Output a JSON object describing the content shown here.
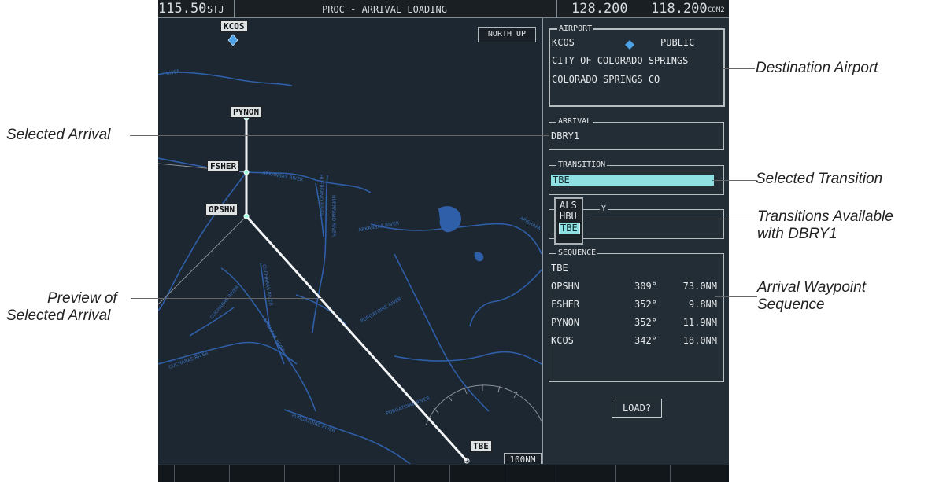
{
  "top_bar": {
    "nav_frequency": "115.50",
    "nav_id": "STJ",
    "page_title": "PROC - ARRIVAL LOADING",
    "com_standby": "128.200",
    "com_active": "118.200",
    "com_label": "COM2"
  },
  "map": {
    "orientation": "NORTH UP",
    "range": "100NM",
    "waypoints": [
      "KCOS",
      "PYNON",
      "FSHER",
      "OPSHN",
      "TBE"
    ]
  },
  "airport": {
    "title": "AIRPORT",
    "id": "KCOS",
    "type": "PUBLIC",
    "name": "CITY OF COLORADO SPRINGS",
    "city": "COLORADO SPRINGS CO"
  },
  "arrival": {
    "title": "ARRIVAL",
    "value": "DBRY1"
  },
  "transition": {
    "title": "TRANSITION",
    "value": "TBE",
    "options": [
      "ALS",
      "HBU",
      "TBE"
    ],
    "selected": "TBE"
  },
  "runway": {
    "title_visible": "Y"
  },
  "sequence": {
    "title": "SEQUENCE",
    "header": "TBE",
    "rows": [
      {
        "wpt": "OPSHN",
        "crs": "309°",
        "dist": "73.0NM"
      },
      {
        "wpt": "FSHER",
        "crs": "352°",
        "dist": "9.8NM"
      },
      {
        "wpt": "PYNON",
        "crs": "352°",
        "dist": "11.9NM"
      },
      {
        "wpt": "KCOS",
        "crs": "342°",
        "dist": "18.0NM"
      }
    ]
  },
  "load_button": "LOAD?",
  "callouts": {
    "destination_airport": "Destination Airport",
    "selected_arrival": "Selected Arrival",
    "selected_transition": "Selected Transition",
    "transitions_available_1": "Transitions Available",
    "transitions_available_2": "with DBRY1",
    "arrival_sequence_1": "Arrival Waypoint",
    "arrival_sequence_2": "Sequence",
    "preview_1": "Preview of",
    "preview_2": "Selected Arrival"
  },
  "colors": {
    "screen_bg": "#1f2a33",
    "river": "#2f5fa8",
    "highlight": "#8ee0e2",
    "airport_symbol": "#4da3e8"
  }
}
